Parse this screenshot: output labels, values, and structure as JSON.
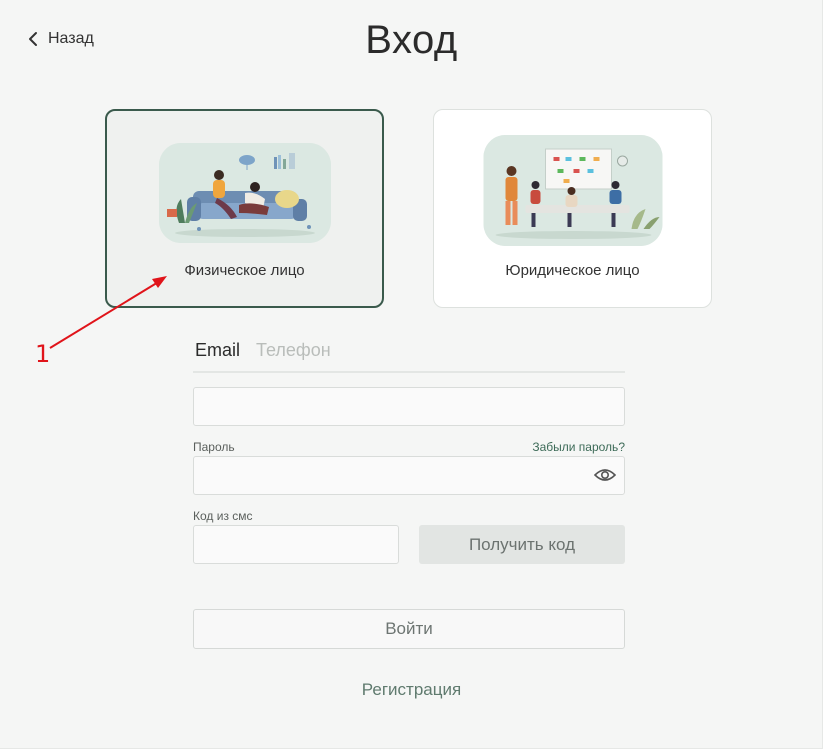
{
  "header": {
    "back_label": "Назад",
    "title": "Вход"
  },
  "account_types": [
    {
      "label": "Физическое лицо",
      "selected": true,
      "illustration": "people-relaxing-on-sofa-illustration"
    },
    {
      "label": "Юридическое лицо",
      "selected": false,
      "illustration": "office-team-meeting-illustration"
    }
  ],
  "annotation": {
    "number": "1",
    "color": "#e0141a"
  },
  "tabs": [
    {
      "label": "Email",
      "active": true
    },
    {
      "label": "Телефон",
      "active": false
    }
  ],
  "form": {
    "email_value": "",
    "password_label": "Пароль",
    "forgot_password": "Забыли пароль?",
    "sms_code_label": "Код из смс",
    "get_code_button": "Получить код",
    "login_button": "Войти",
    "register_link": "Регистрация"
  },
  "colors": {
    "accent": "#3a5a4c",
    "link": "#3d6b58",
    "annotation": "#e0141a"
  }
}
